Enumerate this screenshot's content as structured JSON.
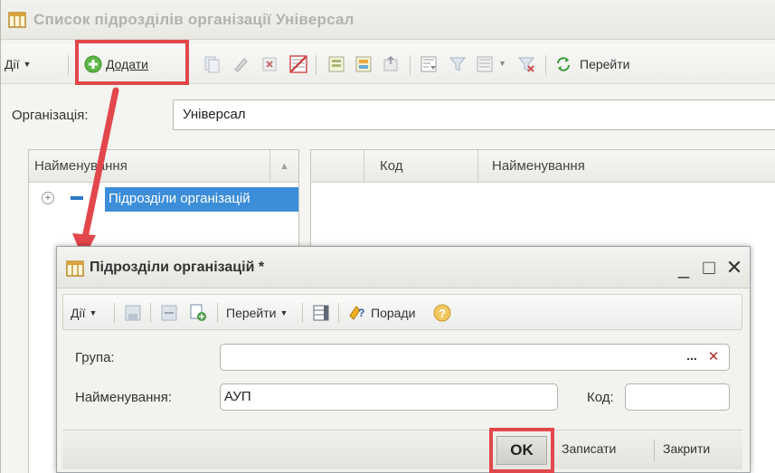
{
  "main_window": {
    "title": "Список підрозділів організації Універсал",
    "toolbar": {
      "actions_label": "Дії",
      "add_label": "Додати",
      "goto_label": "Перейти"
    },
    "organization": {
      "label": "Організація:",
      "value": "Універсал"
    },
    "tree": {
      "header": "Найменування",
      "node_label": "Підрозділи організацій"
    },
    "list": {
      "col_code": "Код",
      "col_name": "Найменування"
    }
  },
  "dialog": {
    "title": "Підрозділи організацій *",
    "toolbar": {
      "actions_label": "Дії",
      "goto_label": "Перейти",
      "tips_label": "Поради"
    },
    "fields": {
      "group_label": "Група:",
      "group_value": "",
      "name_label": "Найменування:",
      "name_value": "АУП",
      "code_label": "Код:",
      "code_value": ""
    },
    "footer": {
      "ok_label": "OK",
      "save_label": "Записати",
      "close_label": "Закрити"
    }
  },
  "colors": {
    "highlight": "#e2474c",
    "selection": "#3c8ed8",
    "add_icon": "#5fb845"
  }
}
